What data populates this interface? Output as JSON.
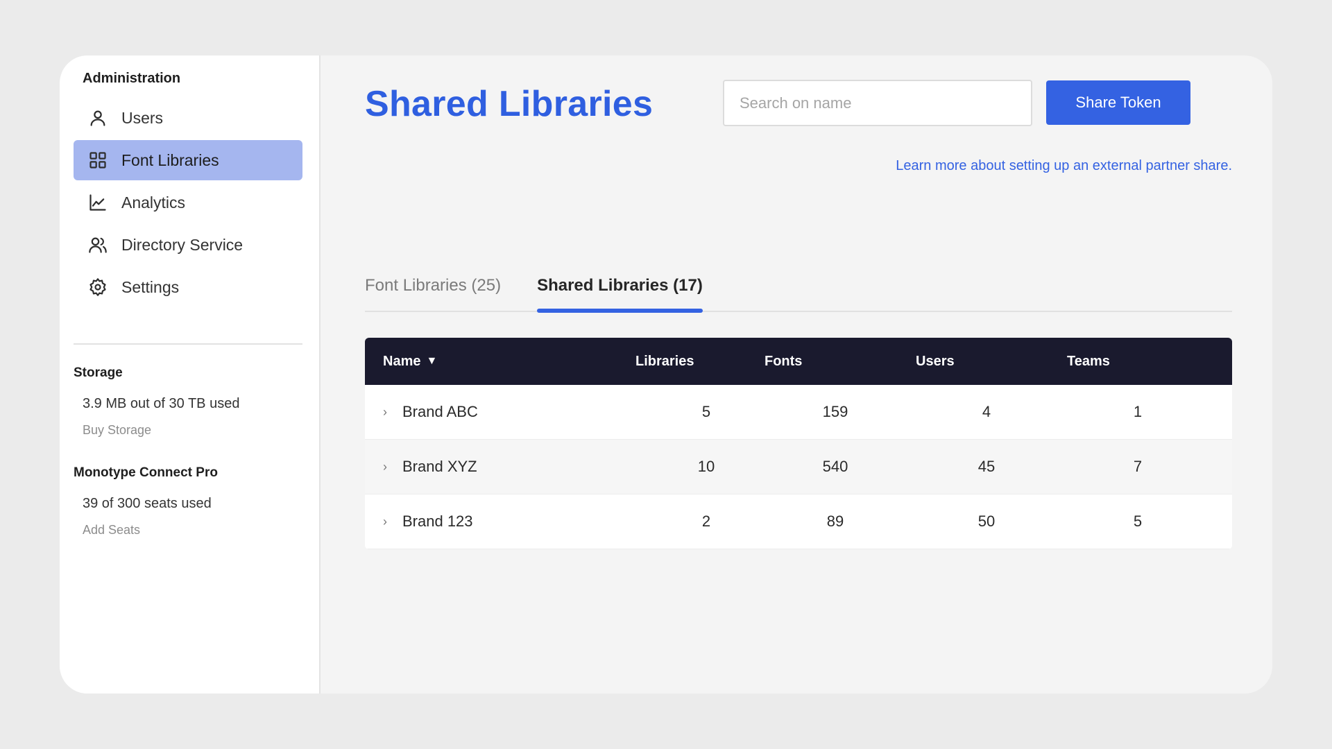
{
  "sidebar": {
    "heading": "Administration",
    "items": [
      {
        "label": "Users",
        "icon": "user-icon",
        "active": false
      },
      {
        "label": "Font Libraries",
        "icon": "grid-icon",
        "active": true
      },
      {
        "label": "Analytics",
        "icon": "line-chart-icon",
        "active": false
      },
      {
        "label": "Directory Service",
        "icon": "users-group-icon",
        "active": false
      },
      {
        "label": "Settings",
        "icon": "gear-icon",
        "active": false
      }
    ],
    "storage": {
      "title": "Storage",
      "value": "3.9 MB out of 30 TB used",
      "link": "Buy Storage"
    },
    "connect": {
      "title": "Monotype Connect Pro",
      "value": "39 of 300 seats used",
      "link": "Add Seats"
    }
  },
  "main": {
    "title": "Shared Libraries",
    "search_placeholder": "Search on name",
    "share_button": "Share Token",
    "learn_link": "Learn more about setting up an external partner share.",
    "tabs": [
      {
        "label": "Font Libraries (25)",
        "active": false
      },
      {
        "label": "Shared Libraries (17)",
        "active": true
      }
    ],
    "table": {
      "headers": {
        "name": "Name",
        "sort_glyph": "▼",
        "libraries": "Libraries",
        "fonts": "Fonts",
        "users": "Users",
        "teams": "Teams"
      },
      "rows": [
        {
          "name": "Brand ABC",
          "libraries": "5",
          "fonts": "159",
          "users": "4",
          "teams": "1"
        },
        {
          "name": "Brand XYZ",
          "libraries": "10",
          "fonts": "540",
          "users": "45",
          "teams": "7"
        },
        {
          "name": "Brand 123",
          "libraries": "2",
          "fonts": "89",
          "users": "50",
          "teams": "5"
        }
      ]
    }
  },
  "colors": {
    "accent": "#3462e2",
    "active_nav": "#a5b6ef",
    "table_header": "#1a1a2e"
  }
}
